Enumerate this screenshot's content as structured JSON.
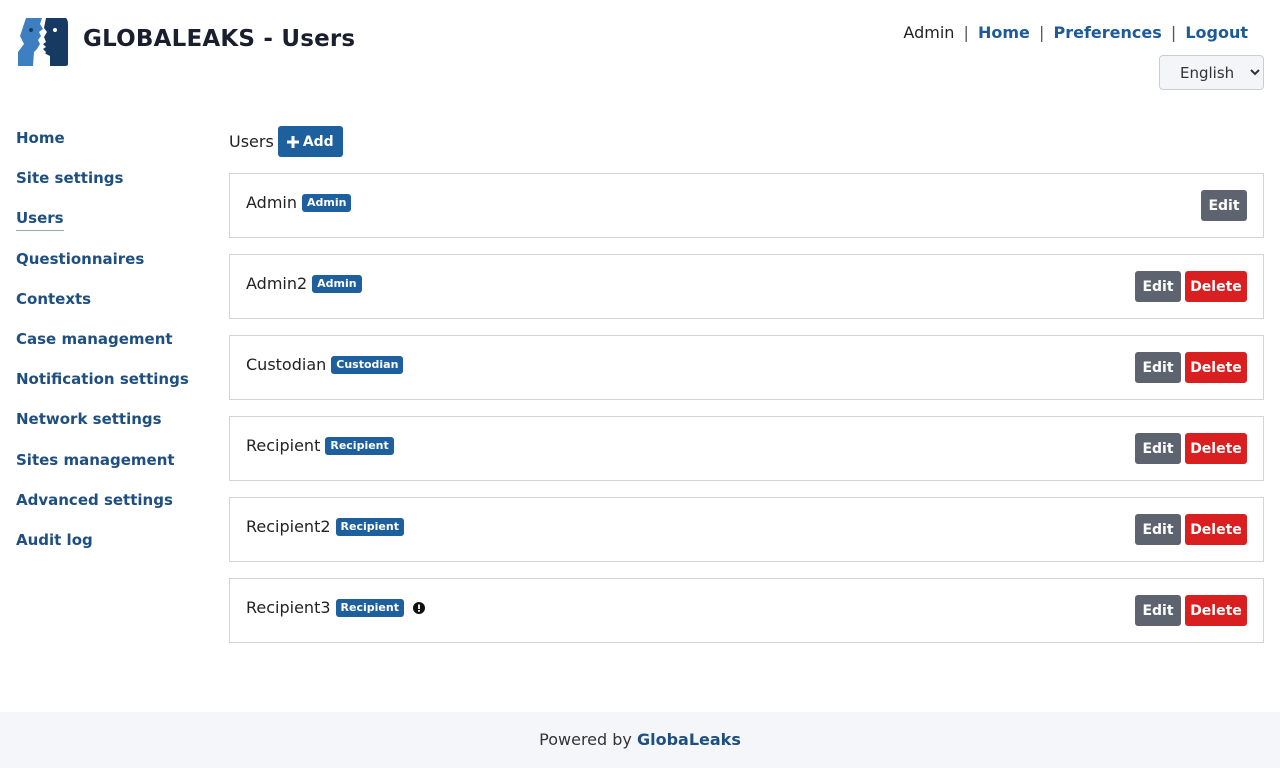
{
  "header": {
    "title": "GLOBALEAKS - Users",
    "user": "Admin",
    "links": {
      "home": "Home",
      "preferences": "Preferences",
      "logout": "Logout"
    },
    "language": "English",
    "separator": "|"
  },
  "sidebar": {
    "items": [
      {
        "label": "Home"
      },
      {
        "label": "Site settings"
      },
      {
        "label": "Users",
        "active": true
      },
      {
        "label": "Questionnaires"
      },
      {
        "label": "Contexts"
      },
      {
        "label": "Case management"
      },
      {
        "label": "Notification settings"
      },
      {
        "label": "Network settings"
      },
      {
        "label": "Sites management"
      },
      {
        "label": "Advanced settings"
      },
      {
        "label": "Audit log"
      }
    ]
  },
  "main": {
    "section_label": "Users",
    "add_label": "Add",
    "edit_label": "Edit",
    "delete_label": "Delete",
    "users": [
      {
        "name": "Admin",
        "role": "Admin",
        "deletable": false,
        "warning": false
      },
      {
        "name": "Admin2",
        "role": "Admin",
        "deletable": true,
        "warning": false
      },
      {
        "name": "Custodian",
        "role": "Custodian",
        "deletable": true,
        "warning": false
      },
      {
        "name": "Recipient",
        "role": "Recipient",
        "deletable": true,
        "warning": false
      },
      {
        "name": "Recipient2",
        "role": "Recipient",
        "deletable": true,
        "warning": false
      },
      {
        "name": "Recipient3",
        "role": "Recipient",
        "deletable": true,
        "warning": true
      }
    ]
  },
  "footer": {
    "prefix": "Powered by",
    "brand": "GlobaLeaks"
  },
  "colors": {
    "accent": "#1e5f9e",
    "link": "#1e4f80",
    "danger": "#d91f1f",
    "neutral": "#5d6470"
  },
  "icons": {
    "logo": "globaleaks-logo",
    "add": "plus-icon",
    "warning": "exclamation-circle-icon"
  }
}
